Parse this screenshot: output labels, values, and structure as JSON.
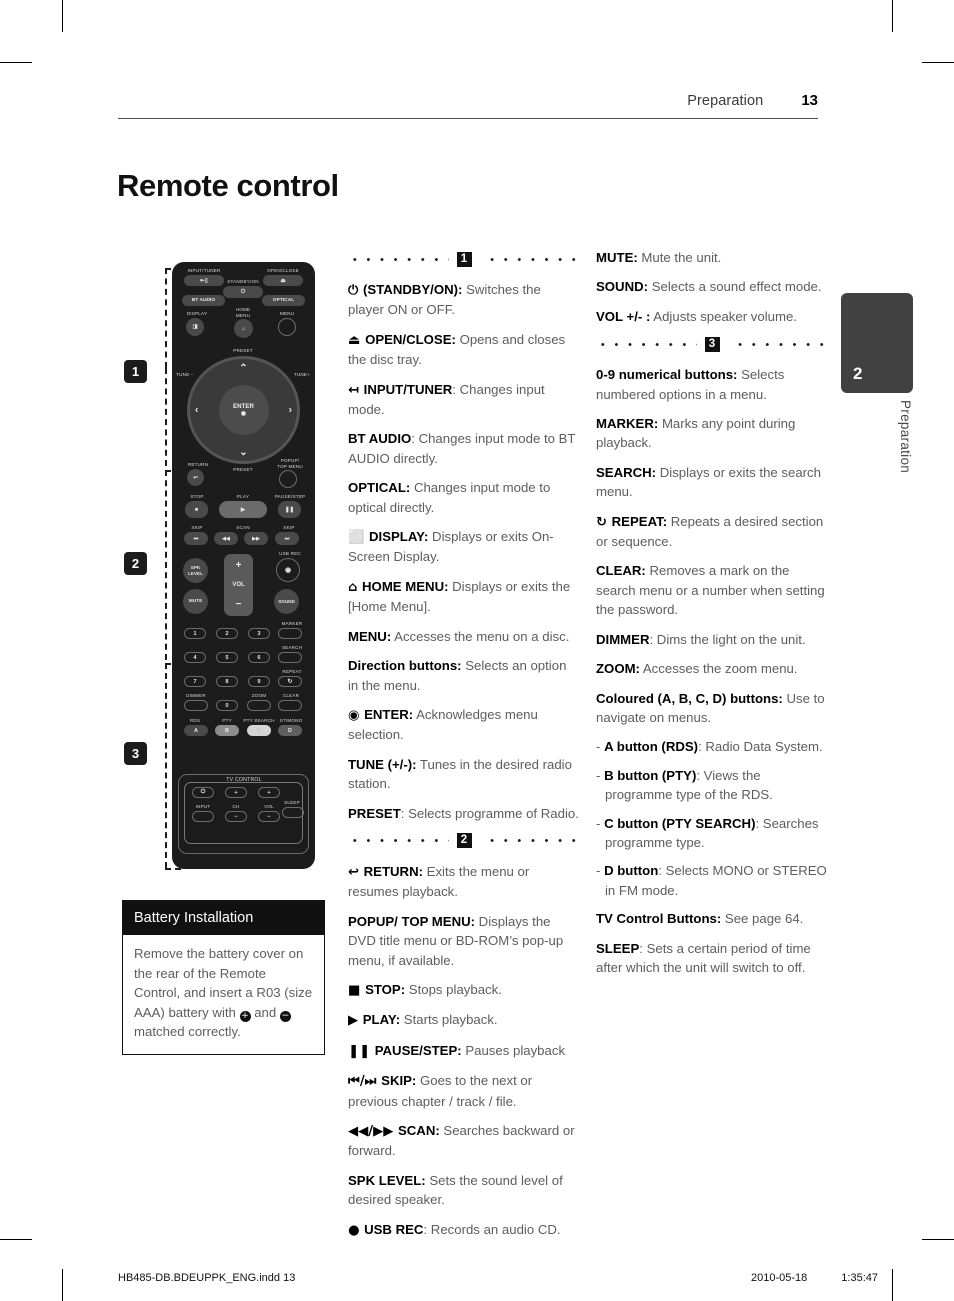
{
  "header": {
    "section": "Preparation",
    "page_number": "13"
  },
  "page_title": "Remote control",
  "side_tab": {
    "number": "2",
    "label": "Preparation"
  },
  "footer": {
    "file": "HB485-DB.BDEUPPK_ENG.indd   13",
    "date": "2010-05-18",
    "time": "1:35:47"
  },
  "section_markers": [
    "1",
    "2",
    "3"
  ],
  "battery": {
    "heading": "Battery Installation",
    "text_1": "Remove the battery cover on the rear of the Remote Control, and insert a R03 (size AAA) battery with ",
    "plus": "+",
    "text_2": " and ",
    "minus": "−",
    "text_3": " matched correctly."
  },
  "sections": {
    "one": {
      "badge": "1",
      "items": [
        {
          "icon": "⏻",
          "label": "(STANDBY/ON):",
          "desc": " Switches the player ON or OFF."
        },
        {
          "icon": "⏏",
          "label": "OPEN/CLOSE:",
          "desc": " Opens and closes the disc tray."
        },
        {
          "icon": "↤",
          "label": "INPUT/TUNER",
          "desc": ": Changes input mode."
        },
        {
          "icon": "",
          "label": "BT AUDIO",
          "desc": ": Changes input mode to BT AUDIO directly."
        },
        {
          "icon": "",
          "label": "OPTICAL:",
          "desc": " Changes input mode to optical directly."
        },
        {
          "icon": "⬜",
          "label": "DISPLAY:",
          "desc": " Displays or exits On-Screen Display."
        },
        {
          "icon": "⌂",
          "label": "HOME MENU:",
          "desc": " Displays or exits the [Home Menu]."
        },
        {
          "icon": "",
          "label": "MENU:",
          "desc": " Accesses the menu on a disc."
        },
        {
          "icon": "",
          "label": "Direction buttons:",
          "desc": " Selects an option in the menu."
        },
        {
          "icon": "◉",
          "label": "ENTER:",
          "desc": " Acknowledges menu selection."
        },
        {
          "icon": "",
          "label": "TUNE (+/-):",
          "desc": " Tunes in the desired radio station."
        },
        {
          "icon": "",
          "label": "PRESET",
          "desc": ": Selects programme of Radio."
        }
      ]
    },
    "two": {
      "badge": "2",
      "items": [
        {
          "icon": "↩",
          "label": "RETURN:",
          "desc": " Exits the menu or resumes playback."
        },
        {
          "icon": "",
          "label": "POPUP/ TOP MENU:",
          "desc": " Displays the DVD title menu or BD-ROM’s pop-up menu, if available."
        },
        {
          "icon": "■",
          "label": "STOP:",
          "desc": " Stops playback."
        },
        {
          "icon": "▶",
          "label": "PLAY:",
          "desc": " Starts playback."
        },
        {
          "icon": "❚❚",
          "label": "PAUSE/STEP:",
          "desc": " Pauses playback"
        },
        {
          "icon": "⏮/⏭",
          "label": "SKIP:",
          "desc": " Goes to the next or previous chapter / track / file."
        },
        {
          "icon": "◀◀/▶▶",
          "label": "SCAN:",
          "desc": " Searches backward or forward."
        },
        {
          "icon": "",
          "label": "SPK LEVEL:",
          "desc": " Sets the sound level of desired speaker."
        },
        {
          "icon": "●",
          "label": "USB REC",
          "desc": ": Records an audio CD."
        }
      ]
    },
    "right_top": {
      "items": [
        {
          "icon": "",
          "label": "MUTE:",
          "desc": " Mute the unit."
        },
        {
          "icon": "",
          "label": "SOUND:",
          "desc": " Selects a sound effect mode."
        },
        {
          "icon": "",
          "label": "VOL +/- :",
          "desc": " Adjusts speaker volume."
        }
      ]
    },
    "three": {
      "badge": "3",
      "items": [
        {
          "icon": "",
          "label": "0-9 numerical buttons:",
          "desc": " Selects numbered options in a menu."
        },
        {
          "icon": "",
          "label": "MARKER:",
          "desc": " Marks any point during playback."
        },
        {
          "icon": "",
          "label": "SEARCH:",
          "desc": " Displays or exits the search menu."
        },
        {
          "icon": "↻",
          "label": "REPEAT:",
          "desc": " Repeats a desired section or sequence."
        },
        {
          "icon": "",
          "label": "CLEAR:",
          "desc": " Removes a mark on the search menu or a number when setting the password."
        },
        {
          "icon": "",
          "label": "DIMMER",
          "desc": ": Dims the light on the unit."
        },
        {
          "icon": "",
          "label": "ZOOM:",
          "desc": " Accesses the zoom menu."
        },
        {
          "icon": "",
          "label": "Coloured (A, B, C, D) buttons:",
          "desc": " Use to navigate on menus."
        }
      ],
      "sub_items": [
        {
          "prefix": "- ",
          "label": "A button (RDS)",
          "desc": ": Radio Data System."
        },
        {
          "prefix": "- ",
          "label": "B button (PTY)",
          "desc": ": Views the programme type of the RDS."
        },
        {
          "prefix": "- ",
          "label": "C button (PTY SEARCH)",
          "desc": ": Searches programme type."
        },
        {
          "prefix": "- ",
          "label": "D button",
          "desc": ": Selects MONO or STEREO in FM mode."
        }
      ],
      "tail_items": [
        {
          "icon": "",
          "label": "TV Control Buttons:",
          "desc": " See page 64."
        },
        {
          "icon": "",
          "label": "SLEEP",
          "desc": ": Sets a certain period of time after which the unit will switch to off."
        }
      ]
    }
  },
  "remote": {
    "labels": {
      "input_tuner": "INPUT/TUNER",
      "standby": "STANDBY/ON",
      "open_close": "OPEN/CLOSE",
      "bt_audio": "BT AUDIO",
      "optical": "OPTICAL",
      "display": "DISPLAY",
      "home_menu_1": "HOME",
      "home_menu_2": "MENU",
      "menu": "MENU",
      "preset_top": "PRESET",
      "preset_bottom": "PRESET",
      "tune_minus": "TUNE −",
      "tune_plus": "TUNE+",
      "enter": "ENTER",
      "return": "RETURN",
      "popup_1": "POPUP/",
      "popup_2": "TOP MENU",
      "stop": "STOP",
      "play": "PLAY",
      "pause_step": "PAUSE/STEP",
      "skip_left": "SKIP",
      "scan": "SCAN",
      "skip_right": "SKIP",
      "spk_1": "SPK",
      "spk_2": "LEVEL",
      "usb_rec": "USB REC",
      "vol": "VOL",
      "vol_plus": "+",
      "vol_minus": "−",
      "mute": "MUTE",
      "sound": "SOUND",
      "marker": "MARKER",
      "search": "SEARCH",
      "repeat": "REPEAT",
      "dimmer": "DIMMER",
      "zoom": "ZOOM",
      "clear": "CLEAR",
      "rds": "RDS",
      "pty": "PTY",
      "pty_search": "PTY SEARCH",
      "st_mono": "ST/MONO",
      "tv_control": "TV CONTROL",
      "tv_input": "INPUT",
      "tv_ch": "CH",
      "tv_vol": "VOL",
      "sleep": "SLEEP"
    },
    "numeric_keys": [
      "1",
      "2",
      "3",
      "4",
      "5",
      "6",
      "7",
      "8",
      "9",
      "0"
    ],
    "colour_keys": [
      "A",
      "B",
      "C",
      "D"
    ]
  }
}
